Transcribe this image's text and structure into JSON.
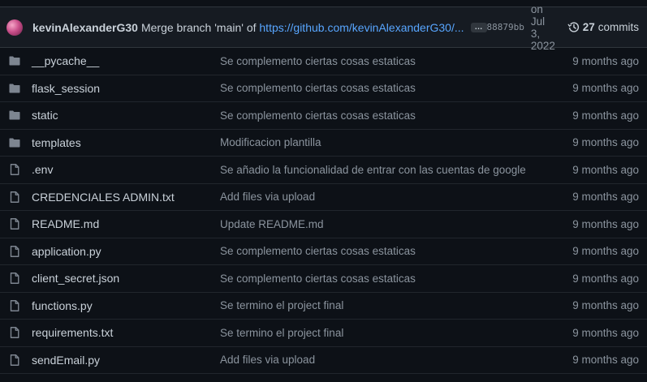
{
  "latest_commit": {
    "author": "kevinAlexanderG30",
    "message_prefix": "Merge branch 'main' of",
    "message_link": "https://github.com/kevinAlexanderG30/...",
    "expand_label": "…",
    "sha": "88879bb",
    "date": "on Jul 3, 2022",
    "commit_count": "27",
    "commits_label": "commits"
  },
  "files": [
    {
      "type": "folder",
      "name": "__pycache__",
      "message": "Se complemento ciertas cosas estaticas",
      "age": "9 months ago"
    },
    {
      "type": "folder",
      "name": "flask_session",
      "message": "Se complemento ciertas cosas estaticas",
      "age": "9 months ago"
    },
    {
      "type": "folder",
      "name": "static",
      "message": "Se complemento ciertas cosas estaticas",
      "age": "9 months ago"
    },
    {
      "type": "folder",
      "name": "templates",
      "message": "Modificacion plantilla",
      "age": "9 months ago"
    },
    {
      "type": "file",
      "name": ".env",
      "message": "Se añadio la funcionalidad de entrar con las cuentas de google",
      "age": "9 months ago"
    },
    {
      "type": "file",
      "name": "CREDENCIALES ADMIN.txt",
      "message": "Add files via upload",
      "age": "9 months ago"
    },
    {
      "type": "file",
      "name": "README.md",
      "message": "Update README.md",
      "age": "9 months ago"
    },
    {
      "type": "file",
      "name": "application.py",
      "message": "Se complemento ciertas cosas estaticas",
      "age": "9 months ago"
    },
    {
      "type": "file",
      "name": "client_secret.json",
      "message": "Se complemento ciertas cosas estaticas",
      "age": "9 months ago"
    },
    {
      "type": "file",
      "name": "functions.py",
      "message": "Se termino el project final",
      "age": "9 months ago"
    },
    {
      "type": "file",
      "name": "requirements.txt",
      "message": "Se termino el project final",
      "age": "9 months ago"
    },
    {
      "type": "file",
      "name": "sendEmail.py",
      "message": "Add files via upload",
      "age": "9 months ago"
    }
  ],
  "colors": {
    "background": "#0d1117",
    "header": "#161b22",
    "link": "#58a6ff",
    "muted": "#8b949e",
    "text": "#c9d1d9"
  }
}
